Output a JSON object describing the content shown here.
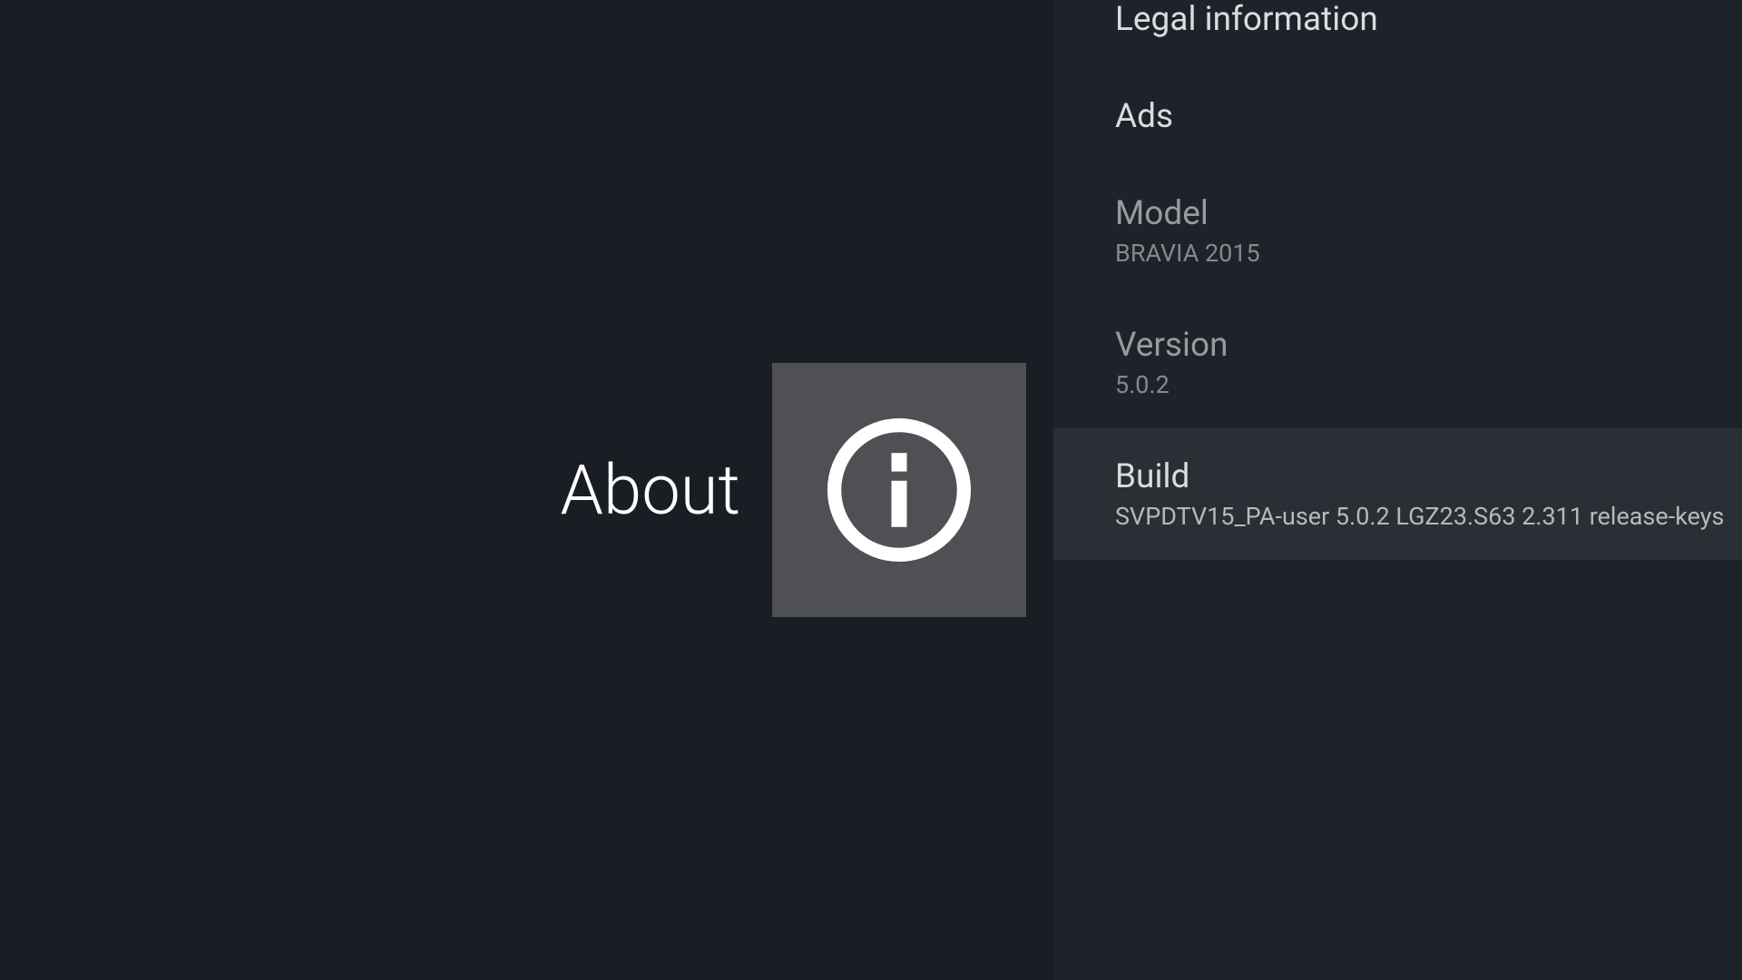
{
  "header": {
    "title": "About"
  },
  "list": {
    "items": [
      {
        "label": "Legal information",
        "value": null
      },
      {
        "label": "Ads",
        "value": null
      },
      {
        "label": "Model",
        "value": "BRAVIA 2015"
      },
      {
        "label": "Version",
        "value": "5.0.2"
      },
      {
        "label": "Build",
        "value": "SVPDTV15_PA-user 5.0.2 LGZ23.S63 2.311 release-keys"
      }
    ]
  }
}
